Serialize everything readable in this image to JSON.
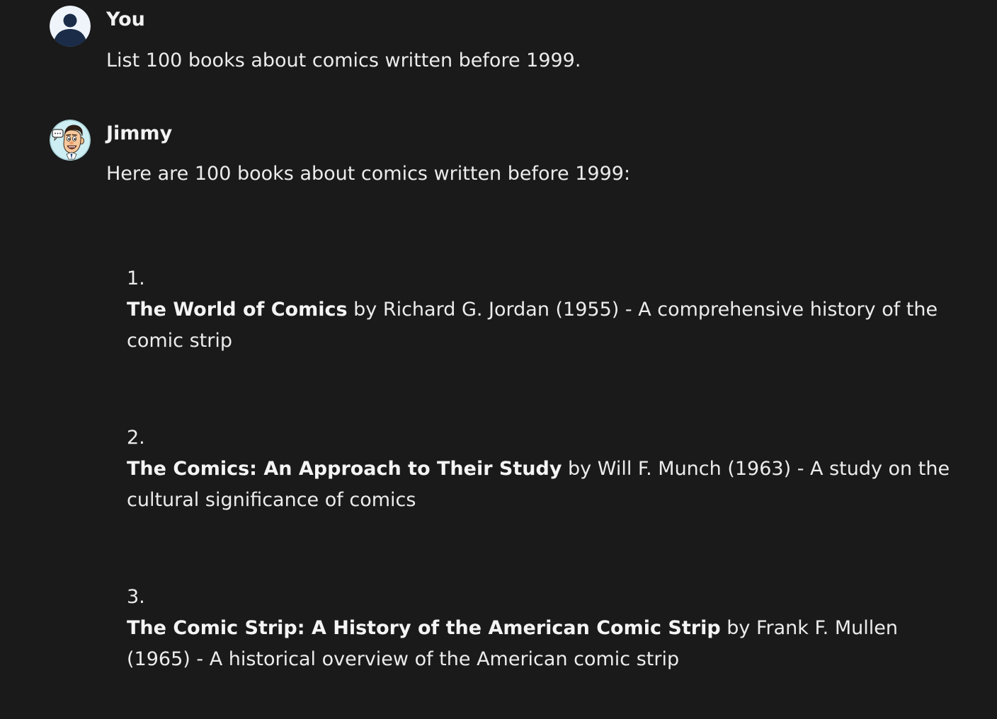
{
  "conversation": {
    "user_message": {
      "author": "You",
      "avatar_icon": "user-silhouette-icon",
      "text": "List 100 books about comics written before 1999."
    },
    "assistant_message": {
      "author": "Jimmy",
      "avatar_icon": "cartoon-face-chat-bubble-icon",
      "intro": "Here are 100 books about comics written before 1999:",
      "books": [
        {
          "number": "1.",
          "title": "The World of Comics",
          "details": " by Richard G. Jordan (1955) - A comprehensive history of the comic strip"
        },
        {
          "number": "2.",
          "title": "The Comics: An Approach to Their Study",
          "details": " by Will F. Munch (1963) - A study on the cultural significance of comics"
        },
        {
          "number": "3.",
          "title": "The Comic Strip: A History of the American Comic Strip",
          "details": " by Frank F. Mullen (1965) - A historical overview of the American comic strip"
        }
      ]
    }
  },
  "colors": {
    "background": "#1a1a1b",
    "text": "#ececec",
    "user_avatar_bg": "#eef4fa",
    "user_avatar_figure": "#1a2c48",
    "assistant_avatar_bg": "#cdeef2"
  }
}
